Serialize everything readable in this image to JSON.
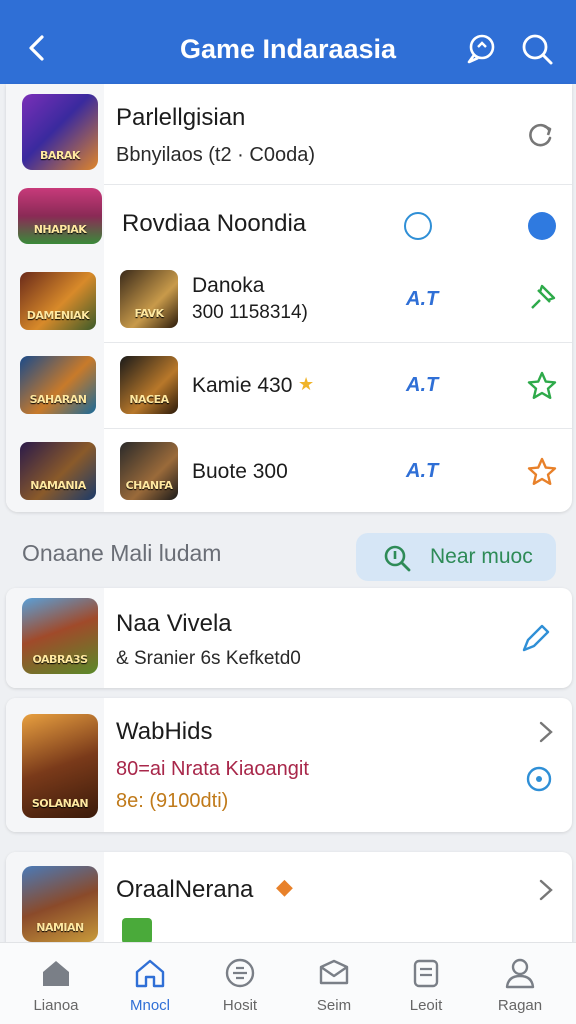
{
  "header": {
    "title": "Game Indaraasia",
    "status_left": "  ",
    "status_right": "  "
  },
  "featured": {
    "title": "Parlellgisian",
    "subtitle": "Bbnyilaos (t2 · C0oda)",
    "thumb_text": "BARAK",
    "row2_title": "Rovdiaa Noondia",
    "row2_thumb_text": "NHAPIAK",
    "items": [
      {
        "name_line1": "Danoka",
        "name_line2": "300 1158314)",
        "badge": "A.T",
        "thumb_left_text": "DAMENIAK",
        "thumb_right_text": "FAVK"
      },
      {
        "name": "Kamie 430",
        "badge": "A.T",
        "thumb_left_text": "SAHARAN",
        "thumb_right_text": "NACEA"
      },
      {
        "name": "Buote 300",
        "badge": "A.T",
        "thumb_left_text": "NAMANIA",
        "thumb_right_text": "CHANFA"
      }
    ]
  },
  "section": {
    "label": "Onaane Mali ludam",
    "button_label": "Near muoc"
  },
  "cards": [
    {
      "title": "Naa Vivela",
      "subtitle": "& Sranier 6s Kefketd0",
      "thumb_text": "OABRA3S"
    },
    {
      "title": "WabHids",
      "line1": "80=ai Nrata Kiaoangit",
      "line2": "8e: (9100dti)",
      "thumb_text": "SOLANAN"
    },
    {
      "title": "OraalNerana",
      "thumb_text": "NAMIAN"
    }
  ],
  "nav": [
    {
      "label": "Lianoa"
    },
    {
      "label": "Mnocl"
    },
    {
      "label": "Hosit"
    },
    {
      "label": "Seim"
    },
    {
      "label": "Leoit"
    },
    {
      "label": "Ragan"
    }
  ],
  "colors": {
    "accent": "#2f6fd6",
    "star_green": "#2eaa4a",
    "star_orange": "#e8812a"
  }
}
